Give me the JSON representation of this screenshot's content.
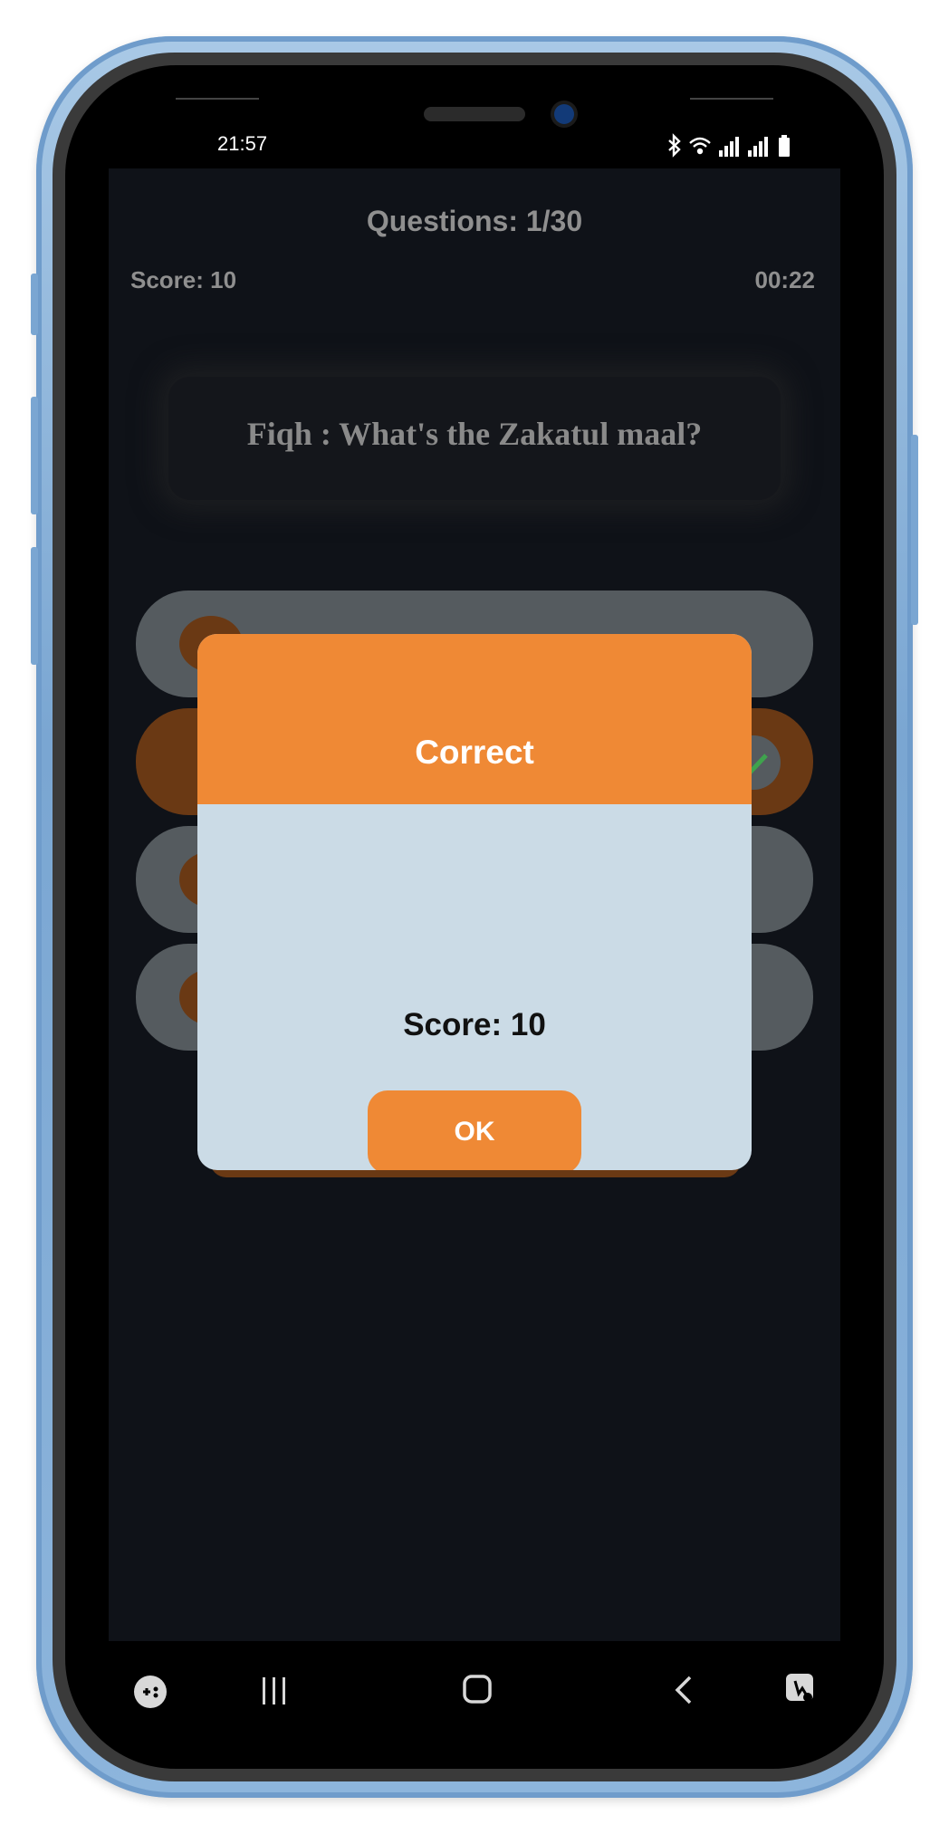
{
  "status_bar": {
    "time": "21:57",
    "icons": [
      "bluetooth-icon",
      "wifi-icon",
      "signal-icon",
      "signal-icon",
      "battery-icon"
    ]
  },
  "quiz": {
    "question_counter": "Questions: 1/30",
    "score": "Score: 10",
    "timer": "00:22",
    "question": "Fiqh : What's the  Zakatul maal?"
  },
  "dialog": {
    "title": "Correct",
    "score": "Score: 10",
    "ok_label": "OK"
  },
  "nav_bar": {
    "icons": [
      "game-launcher-icon",
      "recent-apps-icon",
      "home-icon",
      "back-icon",
      "assistant-icon"
    ]
  },
  "colors": {
    "accent": "#ef8935",
    "dialog_body": "#cbdbe6",
    "screen_bg": "#0f1218",
    "option_bg": "#555b5f",
    "selected_option_bg": "#6a3914",
    "phone_frame": "#8db5dc"
  }
}
